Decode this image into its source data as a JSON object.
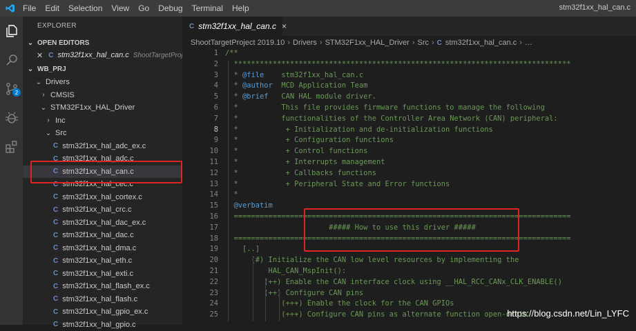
{
  "menu": [
    "File",
    "Edit",
    "Selection",
    "View",
    "Go",
    "Debug",
    "Terminal",
    "Help"
  ],
  "window_title": "stm32f1xx_hal_can.c",
  "scm_badge": "2",
  "explorer": {
    "title": "EXPLORER",
    "open_editors_label": "OPEN EDITORS",
    "open_file_name": "stm32f1xx_hal_can.c",
    "open_file_path": "ShootTargetProj...",
    "project_label": "WB_PRJ",
    "tree": [
      {
        "label": "Drivers",
        "type": "folder",
        "open": true
      },
      {
        "label": "CMSIS",
        "type": "folder",
        "open": false
      },
      {
        "label": "STM32F1xx_HAL_Driver",
        "type": "folder",
        "open": true
      },
      {
        "label": "Inc",
        "type": "folder",
        "open": false
      },
      {
        "label": "Src",
        "type": "folder",
        "open": true
      },
      {
        "label": "stm32f1xx_hal_adc_ex.c",
        "type": "file"
      },
      {
        "label": "stm32f1xx_hal_adc.c",
        "type": "file"
      },
      {
        "label": "stm32f1xx_hal_can.c",
        "type": "file",
        "selected": true
      },
      {
        "label": "stm32f1xx_hal_cec.c",
        "type": "file"
      },
      {
        "label": "stm32f1xx_hal_cortex.c",
        "type": "file"
      },
      {
        "label": "stm32f1xx_hal_crc.c",
        "type": "file"
      },
      {
        "label": "stm32f1xx_hal_dac_ex.c",
        "type": "file"
      },
      {
        "label": "stm32f1xx_hal_dac.c",
        "type": "file"
      },
      {
        "label": "stm32f1xx_hal_dma.c",
        "type": "file"
      },
      {
        "label": "stm32f1xx_hal_eth.c",
        "type": "file"
      },
      {
        "label": "stm32f1xx_hal_exti.c",
        "type": "file"
      },
      {
        "label": "stm32f1xx_hal_flash_ex.c",
        "type": "file"
      },
      {
        "label": "stm32f1xx_hal_flash.c",
        "type": "file"
      },
      {
        "label": "stm32f1xx_hal_gpio_ex.c",
        "type": "file"
      },
      {
        "label": "stm32f1xx_hal_gpio.c",
        "type": "file"
      }
    ]
  },
  "tab": {
    "label": "stm32f1xx_hal_can.c",
    "close": "×",
    "icon": "C"
  },
  "breadcrumb": [
    "ShootTargetProject 2019.10",
    "Drivers",
    "STM32F1xx_HAL_Driver",
    "Src",
    "stm32f1xx_hal_can.c",
    "…"
  ],
  "active_line": 8,
  "code_lines": [
    "/**",
    "  ******************************************************************************",
    "  * @file    stm32f1xx_hal_can.c",
    "  * @author  MCD Application Team",
    "  * @brief   CAN HAL module driver.",
    "  *          This file provides firmware functions to manage the following",
    "  *          functionalities of the Controller Area Network (CAN) peripheral:",
    "  *           + Initialization and de-initialization functions",
    "  *           + Configuration functions",
    "  *           + Control functions",
    "  *           + Interrupts management",
    "  *           + Callbacks functions",
    "  *           + Peripheral State and Error functions",
    "  *",
    "  @verbatim",
    "  ==============================================================================",
    "                        ##### How to use this driver #####",
    "  ==============================================================================",
    "    [..]",
    "      (#) Initialize the CAN low level resources by implementing the",
    "          HAL_CAN_MspInit():",
    "         (++) Enable the CAN interface clock using __HAL_RCC_CANx_CLK_ENABLE()",
    "         (++) Configure CAN pins",
    "             (+++) Enable the clock for the CAN GPIOs",
    "             (+++) Configure CAN pins as alternate function open-drain"
  ],
  "watermark": "https://blog.csdn.net/Lin_LYFC"
}
